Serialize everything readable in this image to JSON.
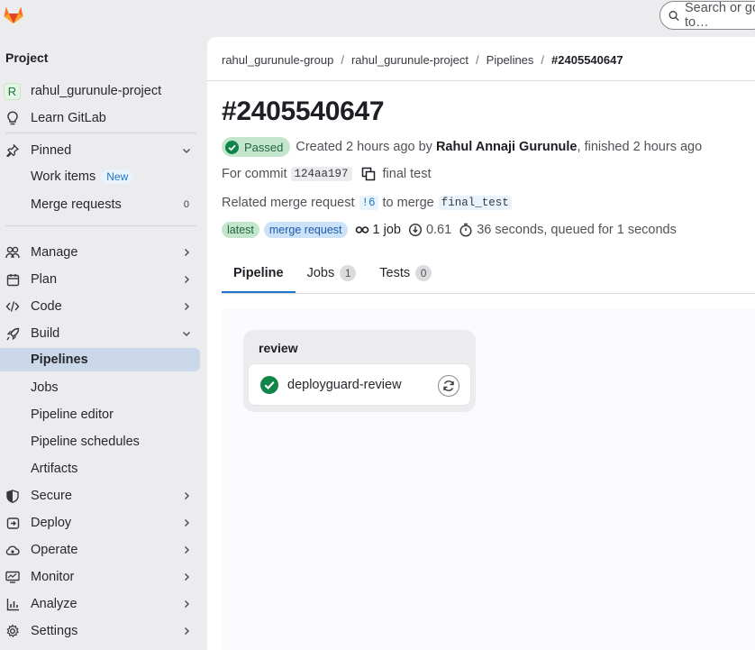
{
  "search": {
    "placeholder": "Search or go to…"
  },
  "sidebar": {
    "heading": "Project",
    "project": {
      "avatar_letter": "R",
      "name": "rahul_gurunule-project"
    },
    "learn": "Learn GitLab",
    "pinned": {
      "label": "Pinned",
      "items": [
        {
          "label": "Work items",
          "badge": "New"
        },
        {
          "label": "Merge requests",
          "count": "0"
        }
      ]
    },
    "sections": [
      {
        "label": "Manage",
        "icon": "users-icon"
      },
      {
        "label": "Plan",
        "icon": "calendar-icon"
      },
      {
        "label": "Code",
        "icon": "code-icon"
      },
      {
        "label": "Build",
        "icon": "rocket-icon"
      }
    ],
    "build_items": [
      "Pipelines",
      "Jobs",
      "Pipeline editor",
      "Pipeline schedules",
      "Artifacts"
    ],
    "more_sections": [
      {
        "label": "Secure",
        "icon": "shield-icon"
      },
      {
        "label": "Deploy",
        "icon": "deploy-icon"
      },
      {
        "label": "Operate",
        "icon": "cloud-gear-icon"
      },
      {
        "label": "Monitor",
        "icon": "monitor-icon"
      },
      {
        "label": "Analyze",
        "icon": "chart-icon"
      },
      {
        "label": "Settings",
        "icon": "gear-icon"
      }
    ]
  },
  "breadcrumb": [
    "rahul_gurunule-group",
    "rahul_gurunule-project",
    "Pipelines",
    "#2405540647"
  ],
  "pipeline": {
    "title": "#2405540647",
    "status": "Passed",
    "created_text": "Created 2 hours ago by",
    "author": "Rahul Annaji Gurunule",
    "finished_text": ", finished 2 hours ago",
    "commit_label": "For commit",
    "commit_sha": "124aa197",
    "commit_message": "final test",
    "mr_label": "Related merge request",
    "mr_ref": "!6",
    "mr_to": "to merge",
    "mr_branch": "final_test",
    "tags": [
      "latest",
      "merge request"
    ],
    "jobs_count": "1 job",
    "cost": "0.61",
    "duration": "36 seconds, queued for 1 seconds"
  },
  "tabs": [
    {
      "label": "Pipeline"
    },
    {
      "label": "Jobs",
      "count": "1"
    },
    {
      "label": "Tests",
      "count": "0"
    }
  ],
  "graph": {
    "stage": "review",
    "job": "deployguard-review"
  },
  "colors": {
    "accent": "#1f75cb",
    "success": "#108548",
    "active_nav": "#cbd8e9"
  }
}
